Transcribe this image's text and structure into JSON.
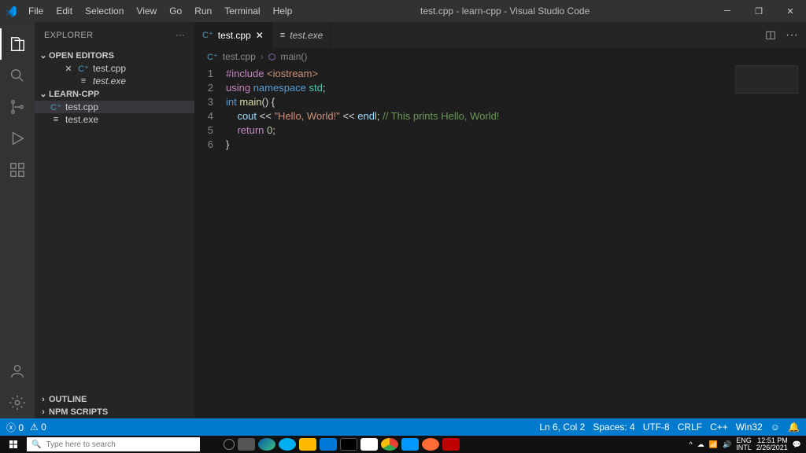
{
  "title": "test.cpp - learn-cpp - Visual Studio Code",
  "menu": [
    "File",
    "Edit",
    "Selection",
    "View",
    "Go",
    "Run",
    "Terminal",
    "Help"
  ],
  "sidebar": {
    "header": "EXPLORER",
    "open_editors": "OPEN EDITORS",
    "items": [
      {
        "label": "test.cpp"
      },
      {
        "label": "test.exe"
      }
    ],
    "folder_header": "LEARN-CPP",
    "folder_items": [
      {
        "label": "test.cpp"
      },
      {
        "label": "test.exe"
      }
    ],
    "outline": "OUTLINE",
    "npm": "NPM SCRIPTS"
  },
  "tabs": [
    {
      "label": "test.cpp",
      "active": true
    },
    {
      "label": "test.exe",
      "active": false,
      "italic": true
    }
  ],
  "breadcrumb": {
    "file": "test.cpp",
    "symbol": "main()"
  },
  "code_lines": [
    "1",
    "2",
    "3",
    "4",
    "5",
    "6"
  ],
  "code": {
    "l1a": "#include",
    "l1b": " <iostream>",
    "l2a": "using",
    "l2b": " namespace",
    "l2c": " std",
    "l2d": ";",
    "l3a": "int",
    "l3b": " main",
    "l3c": "() {",
    "l4a": "    cout ",
    "l4b": "<<",
    "l4c": " \"Hello, World!\"",
    "l4d": " << ",
    "l4e": "endl",
    "l4f": "; ",
    "l4g": "// This prints Hello, World!",
    "l5a": "    ",
    "l5b": "return",
    "l5c": " 0",
    "l5d": ";",
    "l6a": "}"
  },
  "status": {
    "errors": "0",
    "warnings": "0",
    "ln": "Ln 6, Col 2",
    "spaces": "Spaces: 4",
    "enc": "UTF-8",
    "eol": "CRLF",
    "lang": "C++",
    "target": "Win32"
  },
  "taskbar": {
    "search": "Type here to search",
    "lang": "ENG",
    "kbd": "INTL",
    "time": "12:51 PM",
    "date": "2/26/2021"
  }
}
